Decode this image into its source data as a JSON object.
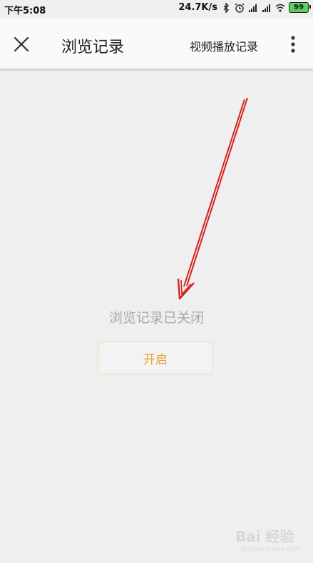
{
  "status_bar": {
    "time": "下午5:08",
    "network_speed": "24.7K/s",
    "battery_level": "99",
    "icons": [
      "bluetooth-icon",
      "alarm-icon",
      "signal-icon",
      "signal-icon",
      "wifi-icon",
      "battery-icon"
    ],
    "battery_color": "#5bd25b"
  },
  "app_bar": {
    "title": "浏览记录",
    "video_history_label": "视频播放记录",
    "icons": [
      "close-icon",
      "more-vertical-icon"
    ]
  },
  "main": {
    "empty_message": "浏览记录已关闭",
    "enable_label": "开启",
    "accent_color": "#f0a030"
  },
  "watermark": {
    "brand": "Bai 经验",
    "url": "jingyan.baidu.com"
  }
}
